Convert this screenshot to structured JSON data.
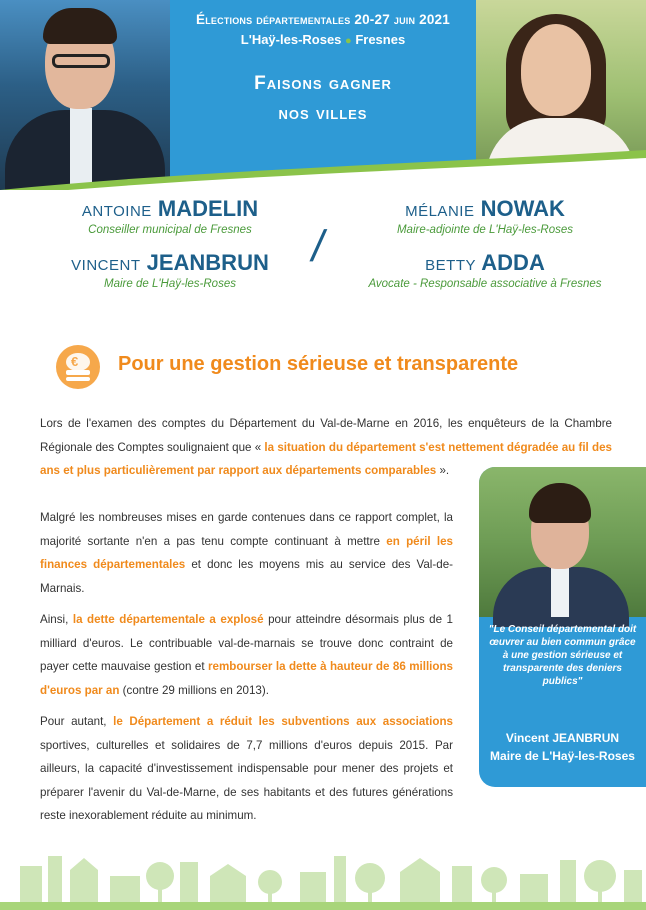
{
  "header": {
    "election": "Élections départementales 20-27 juin 2021",
    "town1": "L'Haÿ-les-Roses",
    "town2": "Fresnes",
    "slogan_line1": "Faisons gagner",
    "slogan_line2": "nos villes",
    "accent_blue": "#2f9ad6",
    "accent_green": "#8bc34a"
  },
  "candidates": {
    "c1": {
      "first": "Antoine",
      "last": "MADELIN",
      "role": "Conseiller municipal de Fresnes"
    },
    "c2": {
      "first": "Vincent",
      "last": "JEANBRUN",
      "role": "Maire de L'Haÿ-les-Roses"
    },
    "c3": {
      "first": "Mélanie",
      "last": "NOWAK",
      "role": "Maire-adjointe de L'Haÿ-les-Roses"
    },
    "c4": {
      "first": "Betty",
      "last": "ADDA",
      "role": "Avocate - Responsable associative à Fresnes"
    },
    "separator": "/"
  },
  "section": {
    "icon": "euro-coins-icon",
    "icon_symbol": "€",
    "title": "Pour une gestion sérieuse et transparente",
    "accent_orange": "#f08a1c"
  },
  "body": {
    "p1_a": "Lors de l'examen des comptes du Département du Val-de-Marne en 2016, les enquêteurs de la Chambre Régionale des Comptes soulignaient que « ",
    "p1_hl": "la situation du département s'est nettement dégradée au fil des ans et plus particulièrement par rapport aux départements comparables",
    "p1_b": " ».",
    "p2_a": "Malgré les nombreuses mises en garde contenues dans ce rapport complet, la majorité sortante n'en a pas tenu compte continuant à mettre ",
    "p2_hl": "en péril les finances départementales",
    "p2_b": " et donc les moyens mis au service des Val-de-Marnais.",
    "p3_a": "Ainsi, ",
    "p3_hl1": "la dette départementale a explosé",
    "p3_b": " pour atteindre désormais plus de 1 milliard d'euros. Le contribuable val-de-marnais se trouve donc contraint de payer cette mauvaise gestion et ",
    "p3_hl2": "rembourser la dette à hauteur de 86 millions d'euros par an",
    "p3_c": " (contre 29 millions en 2013).",
    "p4_a": "Pour autant, ",
    "p4_hl": "le Département a réduit les subventions aux associations",
    "p4_b": " sportives, culturelles et solidaires de 7,7 millions d'euros depuis 2015. Par ailleurs, la capacité d'investissement indispensable pour mener des projets et préparer l'avenir du Val-de-Marne, de ses habitants et des futures générations reste inexorablement réduite au minimum."
  },
  "quote": {
    "text": "\"Le Conseil départemental doit œuvrer au bien commun grâce à une gestion sérieuse et transparente des deniers publics\"",
    "name": "Vincent JEANBRUN",
    "title": "Maire de L'Haÿ-les-Roses"
  }
}
